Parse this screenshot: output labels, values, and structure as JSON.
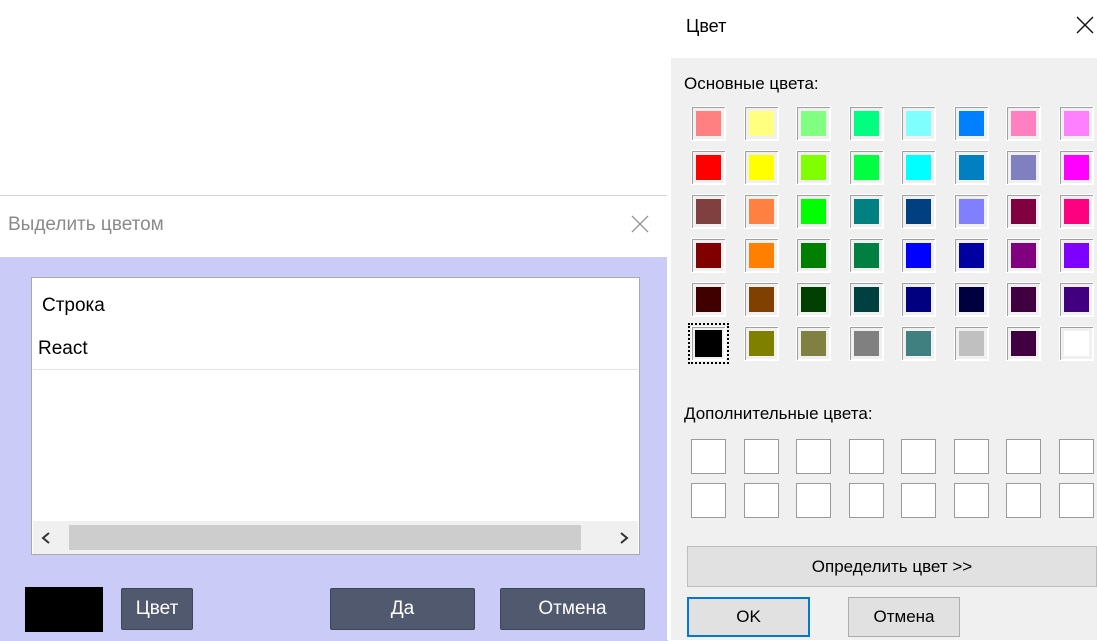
{
  "highlight_dialog": {
    "title": "Выделить цветом",
    "rows": [
      "Строка",
      "React"
    ],
    "selected_color": "#000000",
    "buttons": {
      "color": "Цвет",
      "ok": "Да",
      "cancel": "Отмена"
    }
  },
  "color_dialog": {
    "title": "Цвет",
    "basic_label": "Основные цвета:",
    "custom_label": "Дополнительные цвета:",
    "basic_colors": [
      [
        "#ff8080",
        "#ffff80",
        "#80ff80",
        "#00ff80",
        "#80ffff",
        "#0080ff",
        "#ff80c0",
        "#ff80ff"
      ],
      [
        "#ff0000",
        "#ffff00",
        "#80ff00",
        "#00ff40",
        "#00ffff",
        "#0080c0",
        "#8080c0",
        "#ff00ff"
      ],
      [
        "#804040",
        "#ff8040",
        "#00ff00",
        "#008080",
        "#004080",
        "#8080ff",
        "#800040",
        "#ff0080"
      ],
      [
        "#800000",
        "#ff8000",
        "#008000",
        "#008040",
        "#0000ff",
        "#0000a0",
        "#800080",
        "#8000ff"
      ],
      [
        "#400000",
        "#804000",
        "#004000",
        "#004040",
        "#000080",
        "#000040",
        "#400040",
        "#400080"
      ],
      [
        "#000000",
        "#808000",
        "#808040",
        "#808080",
        "#408080",
        "#c0c0c0",
        "#400040",
        "#ffffff"
      ]
    ],
    "selected_index": [
      5,
      0
    ],
    "custom_colors": [
      [
        "#ffffff",
        "#ffffff",
        "#ffffff",
        "#ffffff",
        "#ffffff",
        "#ffffff",
        "#ffffff",
        "#ffffff"
      ],
      [
        "#ffffff",
        "#ffffff",
        "#ffffff",
        "#ffffff",
        "#ffffff",
        "#ffffff",
        "#ffffff",
        "#ffffff"
      ]
    ],
    "buttons": {
      "define": "Определить цвет >>",
      "ok": "OK",
      "cancel": "Отмена"
    }
  },
  "icons": [
    "close-icon",
    "chevron-left-icon",
    "chevron-right-icon"
  ]
}
